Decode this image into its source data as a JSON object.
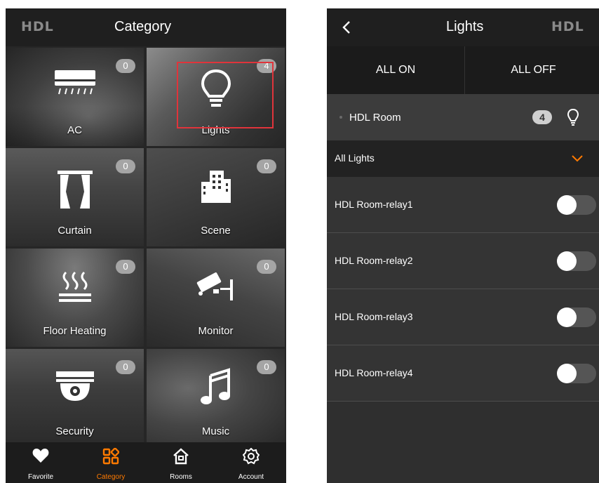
{
  "left_screen": {
    "logo": "HDL",
    "title": "Category",
    "tiles": [
      {
        "label": "AC",
        "count": "0",
        "icon": "air-conditioner-icon"
      },
      {
        "label": "Lights",
        "count": "4",
        "icon": "light-bulb-icon"
      },
      {
        "label": "Curtain",
        "count": "0",
        "icon": "curtain-icon"
      },
      {
        "label": "Scene",
        "count": "0",
        "icon": "buildings-icon"
      },
      {
        "label": "Floor Heating",
        "count": "0",
        "icon": "floor-heating-icon"
      },
      {
        "label": "Monitor",
        "count": "0",
        "icon": "security-camera-icon"
      },
      {
        "label": "Security",
        "count": "0",
        "icon": "dome-camera-icon"
      },
      {
        "label": "Music",
        "count": "0",
        "icon": "music-note-icon"
      }
    ],
    "nav": [
      {
        "label": "Favorite",
        "icon": "heart-icon",
        "active": false
      },
      {
        "label": "Category",
        "icon": "category-grid-icon",
        "active": true
      },
      {
        "label": "Rooms",
        "icon": "home-icon",
        "active": false
      },
      {
        "label": "Account",
        "icon": "gear-icon",
        "active": false
      }
    ],
    "accent_color": "#ff7a00"
  },
  "right_screen": {
    "back_icon": "chevron-left-icon",
    "title": "Lights",
    "logo": "HDL",
    "all_on": "ALL ON",
    "all_off": "ALL OFF",
    "room": {
      "name": "HDL Room",
      "count": "4",
      "icon": "light-bulb-outline-icon"
    },
    "section_label": "All Lights",
    "section_icon": "chevron-down-icon",
    "devices": [
      {
        "name": "HDL Room-relay1",
        "on": false
      },
      {
        "name": "HDL Room-relay2",
        "on": false
      },
      {
        "name": "HDL Room-relay3",
        "on": false
      },
      {
        "name": "HDL Room-relay4",
        "on": false
      }
    ]
  },
  "highlight_color": "#e0343b"
}
